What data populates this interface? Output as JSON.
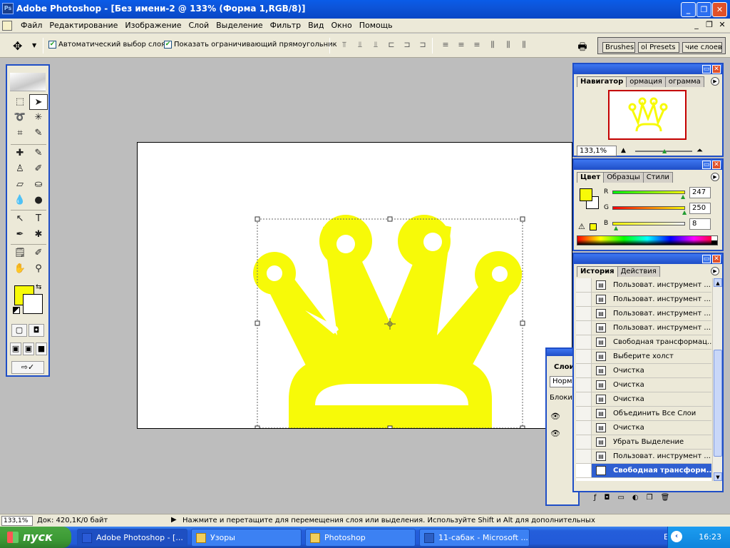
{
  "window": {
    "title": "Adobe Photoshop - [Без имени-2 @ 133% (Форма 1,RGB/8)]",
    "logo": "Ps",
    "btn_min": "_",
    "btn_max": "❐",
    "btn_close": "✕"
  },
  "menu": {
    "items": [
      "Файл",
      "Редактирование",
      "Изображение",
      "Слой",
      "Выделение",
      "Фильтр",
      "Вид",
      "Окно",
      "Помощь"
    ],
    "doc_min": "_",
    "doc_restore": "❐",
    "doc_close": "✕"
  },
  "options": {
    "tool_icon": "move-tool-icon",
    "auto_select_label": "Автоматический выбор слоя",
    "auto_select_checked": true,
    "show_bounds_label": "Показать ограничивающий прямоугольник",
    "show_bounds_checked": true,
    "well_tabs": [
      "Brushes",
      "ol Presets",
      "чие слоев"
    ]
  },
  "colors": {
    "foreground": "#f7fa08",
    "background": "#ffffff",
    "accent": "#1f4ec7",
    "crown": "#f7fa08"
  },
  "navigator": {
    "tabs": [
      "Навигатор",
      "ормация",
      "ограмма"
    ],
    "zoom": "133,1%"
  },
  "color_panel": {
    "tabs": [
      "Цвет",
      "Образцы",
      "Стили"
    ],
    "r_label": "R",
    "r_value": "247",
    "g_label": "G",
    "g_value": "250",
    "b_label": "B",
    "b_value": "8"
  },
  "history": {
    "tabs": [
      "История",
      "Действия"
    ],
    "items": [
      "Пользоват. инструмент ...",
      "Пользоват. инструмент ...",
      "Пользоват. инструмент ...",
      "Пользоват. инструмент ...",
      "Свободная трансформац...",
      "Выберите холст",
      "Очистка",
      "Очистка",
      "Очистка",
      "Объединить Все Слои",
      "Очистка",
      "Убрать Выделение",
      "Пользоват. инструмент ...",
      "Свободная трансформ..."
    ],
    "selected_index": 13
  },
  "layers_partial": {
    "title": "Слои",
    "blend": "Норма",
    "lock": "Блоки"
  },
  "status": {
    "zoom": "133,1%",
    "doc": "Док: 420,1K/0 байт",
    "message": "Нажмите и перетащите для перемещения слоя или выделения. Используйте Shift и Alt для дополнительных"
  },
  "taskbar": {
    "start_label": "пуск",
    "tasks": [
      {
        "label": "Adobe Photoshop - [..."
      },
      {
        "label": "Узоры"
      },
      {
        "label": "Photoshop"
      },
      {
        "label": "11-сабак - Microsoft ..."
      }
    ],
    "lang": "EN",
    "clock": "16:23"
  }
}
